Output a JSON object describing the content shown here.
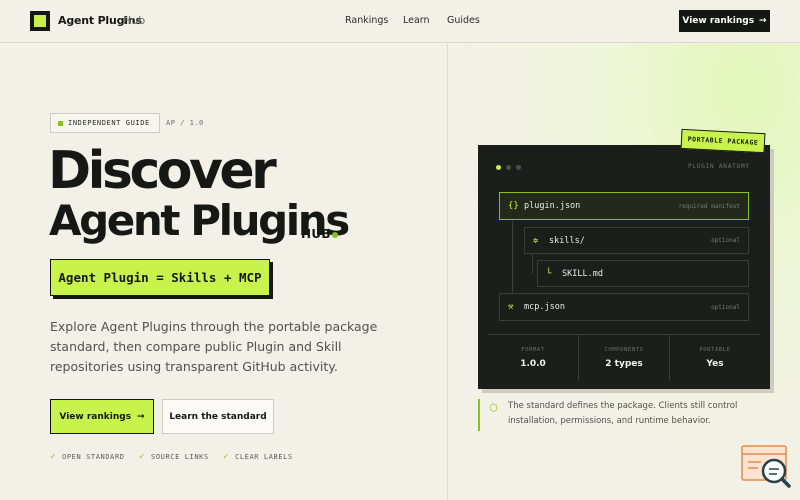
{
  "header": {
    "brand": "Agent Plugins",
    "brand_sub": "Hub",
    "nav": [
      "Rankings",
      "Learn",
      "Guides"
    ],
    "cta": "View rankings"
  },
  "hero": {
    "badge": "INDEPENDENT GUIDE",
    "version": "AP / 1.0",
    "title_line1": "Discover",
    "title_line2": "Agent Plugins",
    "title_suffix": "HUB",
    "formula": "Agent Plugin = Skills + MCP",
    "lead": "Explore Agent Plugins through the portable package standard, then compare public Plugin and Skill repositories using transparent GitHub activity.",
    "primary_button": "View rankings",
    "secondary_button": "Learn the standard",
    "features": [
      "OPEN STANDARD",
      "SOURCE LINKS",
      "CLEAR LABELS"
    ]
  },
  "anatomy": {
    "tag": "PORTABLE PACKAGE",
    "label": "PLUGIN ANATOMY",
    "rows": [
      {
        "name": "plugin.json",
        "note": "required manifest",
        "icon": "braces-icon"
      },
      {
        "name": "skills/",
        "note": "optional",
        "icon": "sparkle-icon"
      },
      {
        "name": "SKILL.md",
        "note": "",
        "icon": "branch-icon"
      },
      {
        "name": "mcp.json",
        "note": "optional",
        "icon": "wrench-icon"
      }
    ],
    "stats": [
      {
        "key": "FORMAT",
        "value": "1.0.0"
      },
      {
        "key": "COMPONENTS",
        "value": "2 types"
      },
      {
        "key": "PORTABLE",
        "value": "Yes"
      }
    ]
  },
  "note": "The standard defines the package. Clients still control installation, permissions, and runtime behavior.",
  "colors": {
    "accent": "#c8f24c",
    "dark": "#151715",
    "background": "#f3f0e8"
  }
}
